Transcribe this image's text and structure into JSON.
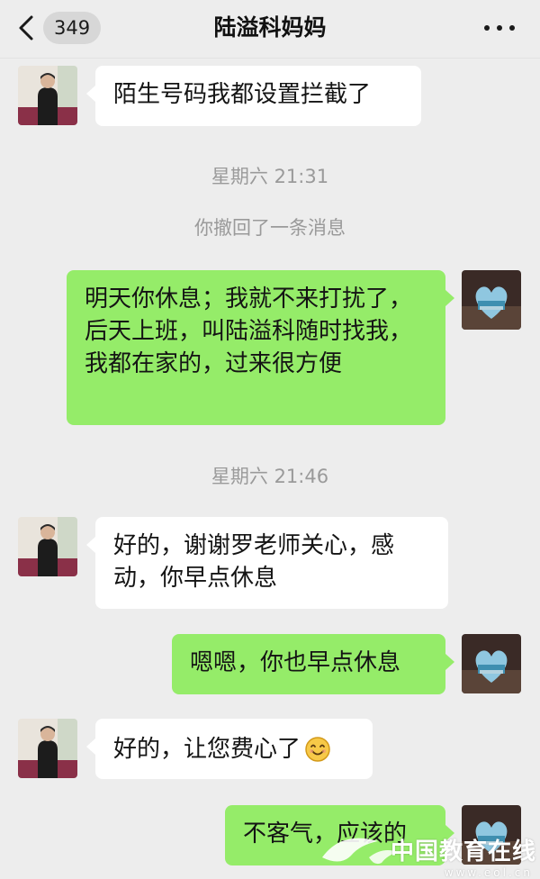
{
  "header": {
    "unread_count": "349",
    "title": "陆溢科妈妈"
  },
  "messages": {
    "m1": "陌生号码我都设置拦截了",
    "sys1": "星期六 21:31",
    "sys2": "你撤回了一条消息",
    "m2": "明天你休息；我就不来打扰了，后天上班，叫陆溢科随时找我，我都在家的，过来很方便",
    "sys3": "星期六 21:46",
    "m3": "好的，谢谢罗老师关心，感动，你早点休息",
    "m4": "嗯嗯，你也早点休息",
    "m5": "好的，让您费心了",
    "m6": "不客气，应该的"
  },
  "watermark": {
    "text": "中国教育在线",
    "sub": "www.eol.cn"
  },
  "colors": {
    "background": "#ededed",
    "outgoing_bubble": "#95ec69",
    "incoming_bubble": "#ffffff"
  },
  "icons": [
    "back-chevron-icon",
    "more-dots-icon",
    "smile-emoji-icon"
  ]
}
